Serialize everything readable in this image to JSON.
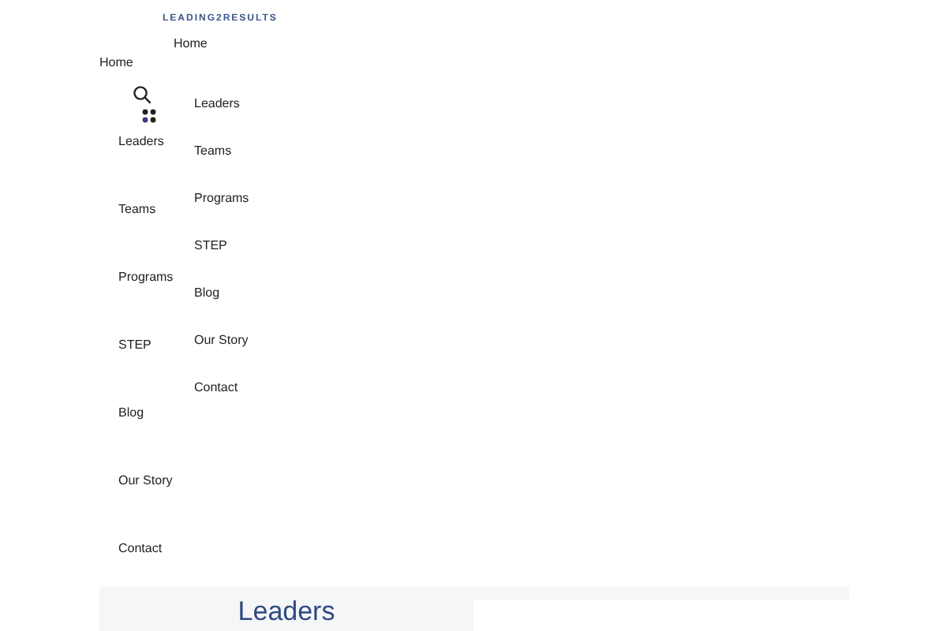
{
  "logo": {
    "text": "LEADING2RESULTS"
  },
  "top_link": "Home",
  "sidebar": {
    "home": "Home",
    "items": [
      "Leaders",
      "Teams",
      "Programs",
      "STEP",
      "Blog",
      "Our Story",
      "Contact"
    ]
  },
  "menu": {
    "items": [
      "Leaders",
      "Teams",
      "Programs",
      "STEP",
      "Blog",
      "Our Story",
      "Contact"
    ]
  },
  "section": {
    "heading": "Leaders"
  }
}
